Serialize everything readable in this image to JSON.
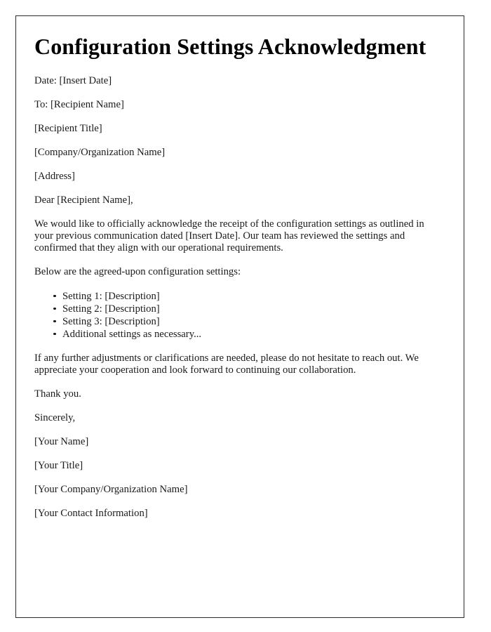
{
  "document": {
    "title": "Configuration Settings Acknowledgment",
    "header_lines": [
      "Date: [Insert Date]",
      "To: [Recipient Name]",
      "[Recipient Title]",
      "[Company/Organization Name]",
      "[Address]"
    ],
    "salutation": "Dear [Recipient Name],",
    "intro_paragraph": "We would like to officially acknowledge the receipt of the configuration settings as outlined in your previous communication dated [Insert Date]. Our team has reviewed the settings and confirmed that they align with our operational requirements.",
    "list_intro": "Below are the agreed-upon configuration settings:",
    "settings_list": [
      "Setting 1: [Description]",
      "Setting 2: [Description]",
      "Setting 3: [Description]",
      "Additional settings as necessary..."
    ],
    "closing_paragraph": "If any further adjustments or clarifications are needed, please do not hesitate to reach out. We appreciate your cooperation and look forward to continuing our collaboration.",
    "thanks": "Thank you.",
    "sign_off": "Sincerely,",
    "signature_lines": [
      "[Your Name]",
      "[Your Title]",
      "[Your Company/Organization Name]",
      "[Your Contact Information]"
    ]
  },
  "style": {
    "page_background": "#ffffff",
    "border_color": "#2b2b2b",
    "text_color": "#1a1a1a",
    "title_color": "#000000"
  }
}
